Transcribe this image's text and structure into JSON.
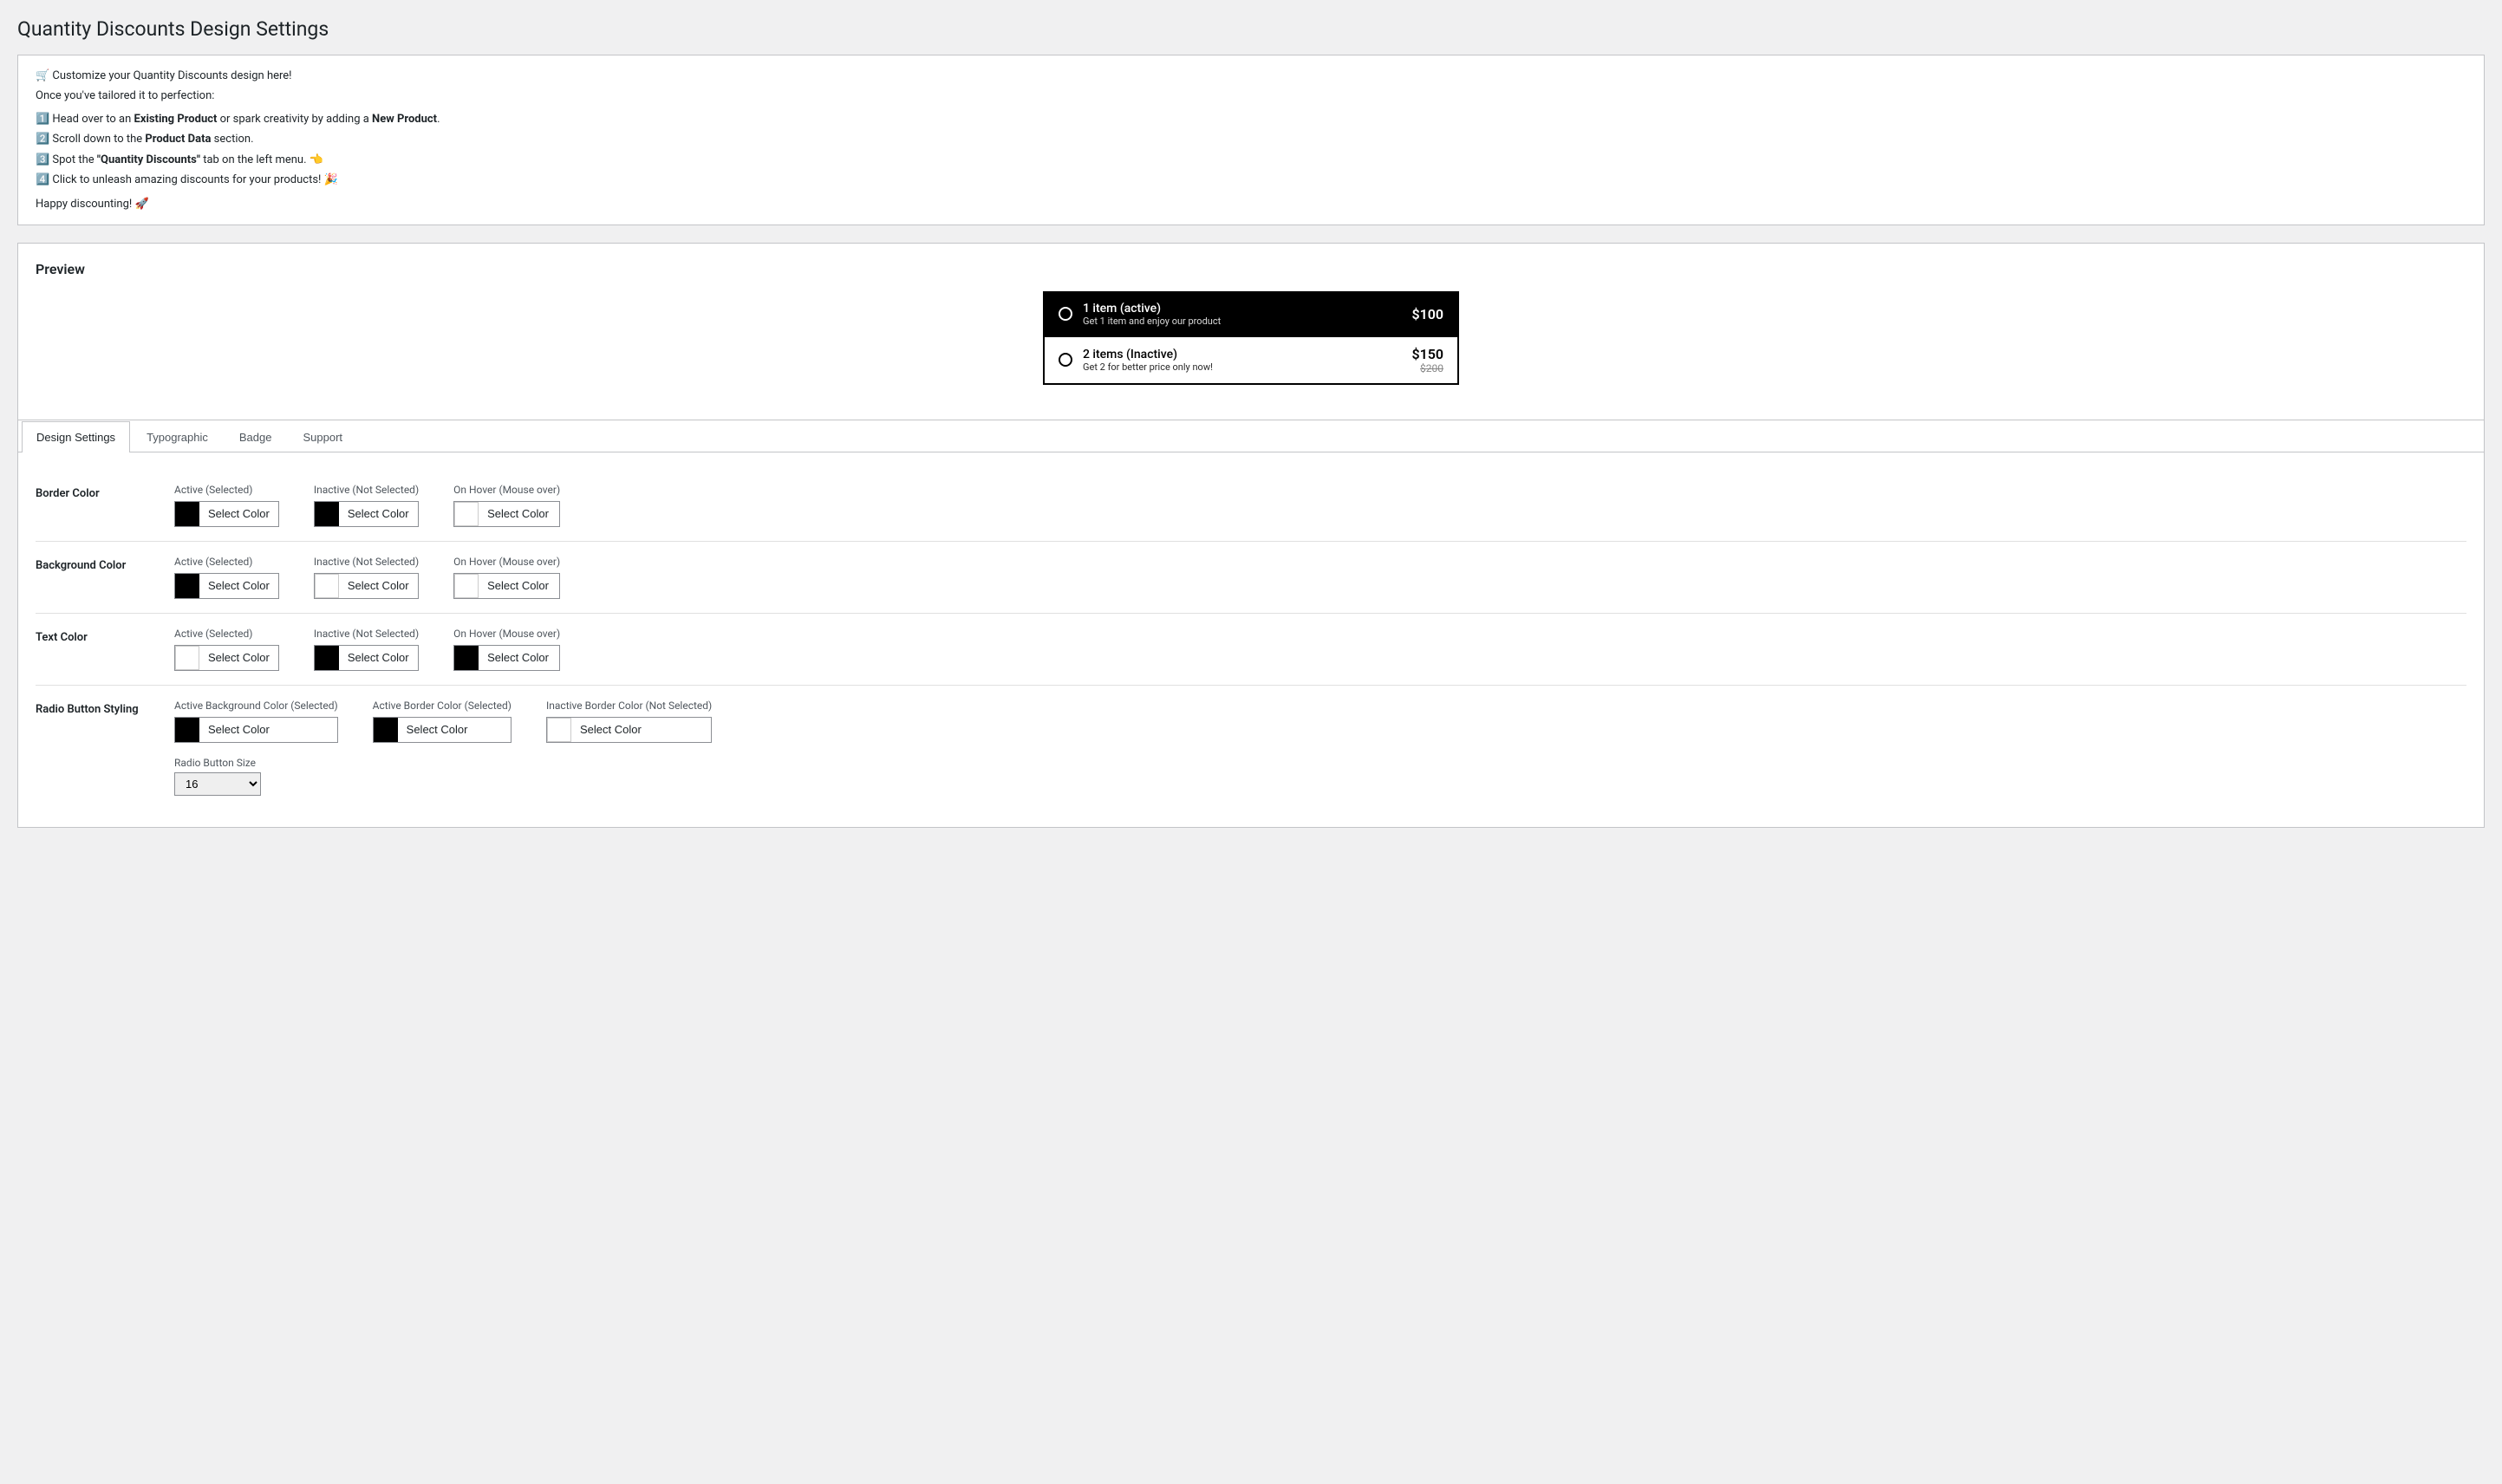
{
  "page": {
    "title": "Quantity Discounts Design Settings"
  },
  "intro": {
    "emoji_line": "🛒 Customize your Quantity Discounts design here!",
    "once_line": "Once you've tailored it to perfection:",
    "steps": [
      "1️⃣ Head over to an Existing Product or spark creativity by adding a New Product.",
      "2️⃣ Scroll down to the Product Data section.",
      "3️⃣ Spot the \"Quantity Discounts\" tab on the left menu. 👈",
      "4️⃣ Click to unleash amazing discounts for your products! 🎉"
    ],
    "happy": "Happy discounting! 🚀"
  },
  "preview": {
    "title": "Preview",
    "item_active": {
      "label": "1 item (active)",
      "subtitle": "Get 1 item and enjoy our product",
      "price": "$100"
    },
    "item_inactive": {
      "label": "2 items (Inactive)",
      "subtitle": "Get 2 for better price only now!",
      "price": "$150",
      "price_old": "$200"
    }
  },
  "tabs": [
    {
      "id": "design",
      "label": "Design Settings",
      "active": true
    },
    {
      "id": "typographic",
      "label": "Typographic",
      "active": false
    },
    {
      "id": "badge",
      "label": "Badge",
      "active": false
    },
    {
      "id": "support",
      "label": "Support",
      "active": false
    }
  ],
  "design_settings": [
    {
      "id": "border-color",
      "label": "Border Color",
      "options": [
        {
          "id": "border-active",
          "label": "Active (Selected)",
          "swatch": "#000000",
          "btn_label": "Select Color"
        },
        {
          "id": "border-inactive",
          "label": "Inactive (Not Selected)",
          "swatch": "#000000",
          "btn_label": "Select Color"
        },
        {
          "id": "border-hover",
          "label": "On Hover (Mouse over)",
          "swatch": "#ffffff",
          "btn_label": "Select Color"
        }
      ]
    },
    {
      "id": "background-color",
      "label": "Background Color",
      "options": [
        {
          "id": "bg-active",
          "label": "Active (Selected)",
          "swatch": "#000000",
          "btn_label": "Select Color"
        },
        {
          "id": "bg-inactive",
          "label": "Inactive (Not Selected)",
          "swatch": "#ffffff",
          "btn_label": "Select Color"
        },
        {
          "id": "bg-hover",
          "label": "On Hover (Mouse over)",
          "swatch": "#ffffff",
          "btn_label": "Select Color"
        }
      ]
    },
    {
      "id": "text-color",
      "label": "Text Color",
      "options": [
        {
          "id": "text-active",
          "label": "Active (Selected)",
          "swatch": "#ffffff",
          "btn_label": "Select Color"
        },
        {
          "id": "text-inactive",
          "label": "Inactive (Not Selected)",
          "swatch": "#000000",
          "btn_label": "Select Color"
        },
        {
          "id": "text-hover",
          "label": "On Hover (Mouse over)",
          "swatch": "#000000",
          "btn_label": "Select Color"
        }
      ]
    },
    {
      "id": "radio-button-styling",
      "label": "Radio Button Styling",
      "options": [
        {
          "id": "radio-bg-active",
          "label": "Active Background Color (Selected)",
          "swatch": "#000000",
          "btn_label": "Select Color"
        },
        {
          "id": "radio-border-active",
          "label": "Active Border Color (Selected)",
          "swatch": "#000000",
          "btn_label": "Select Color"
        },
        {
          "id": "radio-border-inactive",
          "label": "Inactive Border Color (Not Selected)",
          "swatch": "#ffffff",
          "btn_label": "Select Color"
        }
      ],
      "extra_label": "Radio Button Size"
    }
  ]
}
